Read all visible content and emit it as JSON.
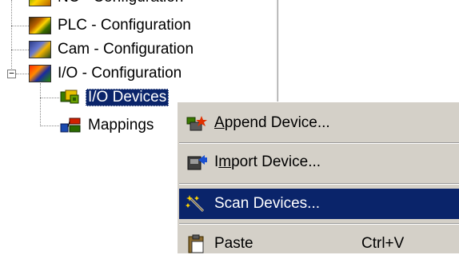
{
  "tree": {
    "items": [
      {
        "label": "NC - Configuration",
        "icon": "nc-config-icon"
      },
      {
        "label": "PLC - Configuration",
        "icon": "plc-config-icon"
      },
      {
        "label": "Cam - Configuration",
        "icon": "cam-config-icon"
      },
      {
        "label": "I/O - Configuration",
        "icon": "io-config-icon",
        "expander": "−"
      },
      {
        "label": "I/O Devices",
        "icon": "io-devices-icon",
        "selected": true
      },
      {
        "label": "Mappings",
        "icon": "mappings-icon"
      }
    ]
  },
  "context_menu": {
    "items": [
      {
        "pre": "",
        "accel": "A",
        "post": "ppend Device...",
        "icon": "append-device-icon"
      },
      {
        "pre": "I",
        "accel": "m",
        "post": "port Device...",
        "icon": "import-device-icon"
      },
      {
        "pre": "Scan Devices...",
        "accel": "",
        "post": "",
        "icon": "scan-devices-icon",
        "highlighted": true
      },
      {
        "pre": "Paste",
        "accel": "",
        "post": "",
        "icon": "paste-icon",
        "shortcut": "Ctrl+V"
      }
    ]
  },
  "colors": {
    "selection": "#0a246a",
    "menu_background": "#d4d0c8"
  }
}
